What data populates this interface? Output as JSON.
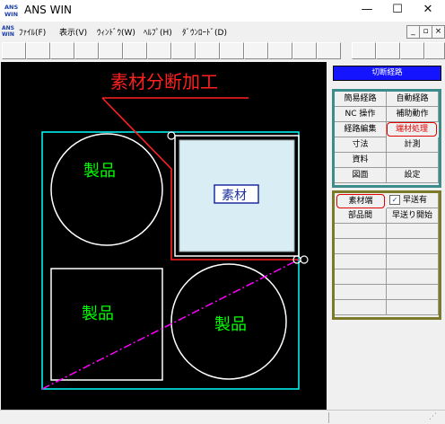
{
  "window": {
    "logo_text": "ANS WIN",
    "title": "ANS WIN",
    "controls": {
      "minimize": "—",
      "maximize": "☐",
      "close": "✕"
    }
  },
  "menu": {
    "items": [
      "ﾌｧｲﾙ(F)",
      "表示(V)",
      "ｳｨﾝﾄﾞｳ(W)",
      "ﾍﾙﾌﾟ(H)",
      "ﾀﾞｳﾝﾛｰﾄﾞ(D)"
    ],
    "mdi_controls": {
      "minimize": "_",
      "restore": "▫",
      "close": "×"
    }
  },
  "canvas": {
    "annotation": "素材分断加工",
    "product_labels": [
      "製品",
      "製品",
      "製品"
    ],
    "material_label": "素材",
    "colors": {
      "background": "#000000",
      "sheet": "#00ffff",
      "parts": "#ffffff",
      "product_text": "#00ff00",
      "annotation": "#ff0000",
      "diagonal": "#ff00ff"
    }
  },
  "panel": {
    "header": "切断経路",
    "group1": [
      [
        "簡易経路",
        "自動経路"
      ],
      [
        "NC 操作",
        "補助動作"
      ],
      [
        "経路編集",
        "端材処理"
      ],
      [
        "寸法",
        "計測"
      ],
      [
        "資料",
        ""
      ],
      [
        "図面",
        "設定"
      ]
    ],
    "highlighted_group1": "端材処理",
    "group2": [
      [
        "素材端",
        "早送有"
      ],
      [
        "部品間",
        "早送り開始"
      ],
      [
        "",
        ""
      ],
      [
        "",
        ""
      ],
      [
        "",
        ""
      ],
      [
        "",
        ""
      ],
      [
        "",
        ""
      ],
      [
        "",
        ""
      ]
    ],
    "highlighted_group2": "素材端",
    "colors": {
      "group1_border": "#3c8c8c",
      "group2_border": "#7a7a28",
      "highlight": "#e00000",
      "header_bg": "#1414ff"
    }
  }
}
